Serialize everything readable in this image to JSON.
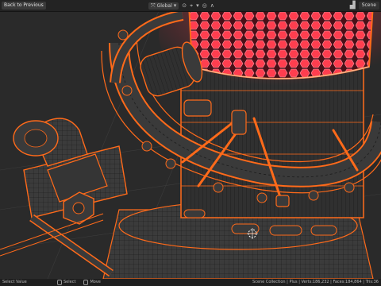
{
  "header": {
    "back_label": "Back to Previous",
    "orientation_label": "Global",
    "scene_label": "Scene"
  },
  "status": {
    "left_text": "Select Value",
    "select_label": "Select",
    "move_label": "Move",
    "stats_text": "Scene Collection | Plus | Verts:186,232 | Faces:184,864 | Tris:36"
  },
  "colors": {
    "wire": "#ff6a1a",
    "glow": "#ff3344",
    "mesh_fill": "#3a3a3a",
    "background": "#2b2b2b"
  }
}
